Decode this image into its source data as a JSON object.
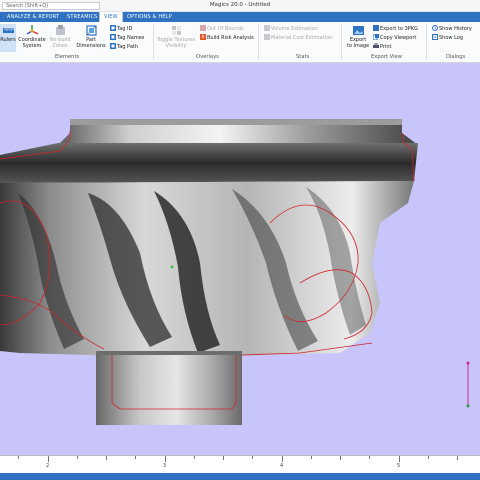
{
  "titlebar": {
    "search_placeholder": "Search (Shift+Q)",
    "app_title": "Magics 20.0 - Untitled"
  },
  "tabs": [
    {
      "label": "ANALYZE & REPORT",
      "active": false
    },
    {
      "label": "STREAMICS",
      "active": false
    },
    {
      "label": "VIEW",
      "active": true
    },
    {
      "label": "OPTIONS & HELP",
      "active": false
    }
  ],
  "ribbon": {
    "elements": {
      "group_label": "Elements",
      "rulers_label": "Rulers",
      "coordinate_label_1": "Coordinate",
      "coordinate_label_2": "System",
      "nobuild_label_1": "No-build",
      "nobuild_label_2": "Zones",
      "part_dims_label_1": "Part",
      "part_dims_label_2": "Dimensions",
      "tag_id": "Tag ID",
      "tag_names": "Tag Names",
      "tag_path": "Tag Path"
    },
    "overlays": {
      "group_label": "Overlays",
      "toggle_textures_1": "Toggle Textures",
      "toggle_textures_2": "Visibility",
      "out_of_bounds": "Out Of Bounds",
      "build_risk": "Build Risk Analysis"
    },
    "stats": {
      "group_label": "Stats",
      "volume_estimation": "Volume Estimation",
      "material_cost": "Material Cost Estimation"
    },
    "export_view": {
      "group_label": "Export View",
      "export_image_1": "Export",
      "export_image_2": "to Image",
      "export_3pkg": "Export to 3PKG",
      "copy_viewport": "Copy Viewport",
      "print": "Print"
    },
    "dialogs": {
      "group_label": "Dialogs",
      "show_history": "Show History",
      "show_log": "Show Log"
    }
  },
  "ruler": {
    "labels": [
      "2",
      "3",
      "4",
      "5"
    ]
  },
  "colors": {
    "accent": "#2f72c2",
    "viewport_bg": "#c7c5fa",
    "contour_red": "#d0242a"
  }
}
